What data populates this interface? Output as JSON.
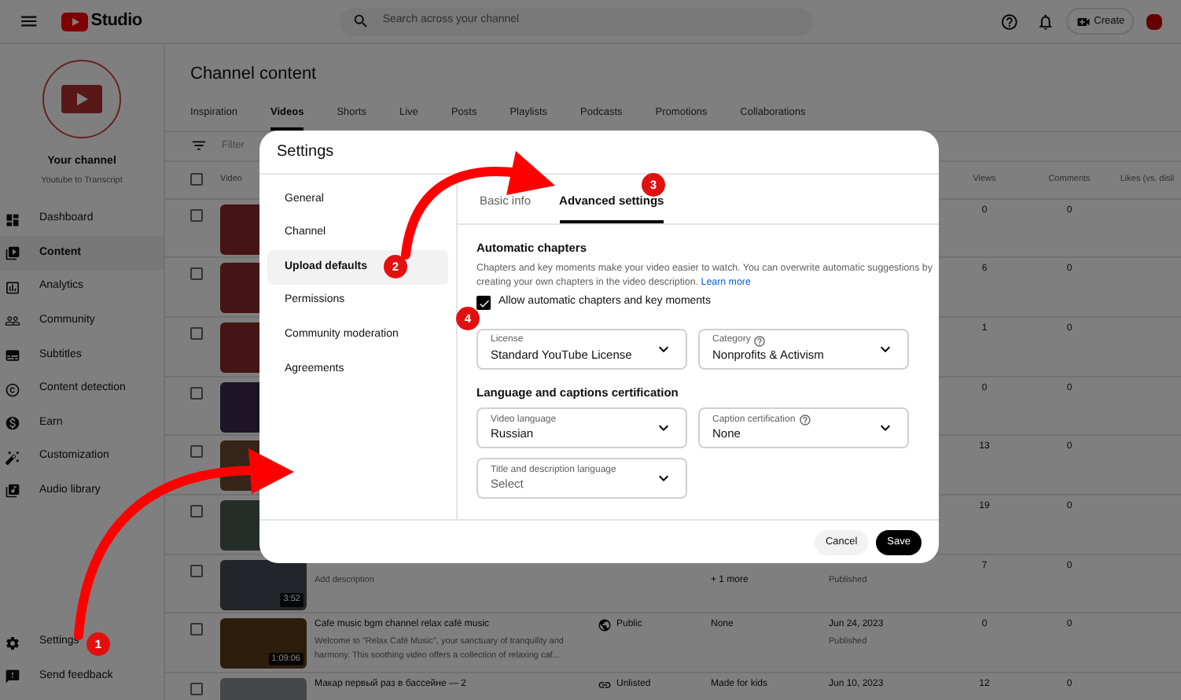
{
  "header": {
    "logo_text": "Studio",
    "search_placeholder": "Search across your channel",
    "create_label": "Create"
  },
  "sidebar": {
    "channel_name": "Your channel",
    "channel_handle": "Youtube to Transcript",
    "items": [
      {
        "label": "Dashboard",
        "selected": false
      },
      {
        "label": "Content",
        "selected": true
      },
      {
        "label": "Analytics",
        "selected": false
      },
      {
        "label": "Community",
        "selected": false
      },
      {
        "label": "Subtitles",
        "selected": false
      },
      {
        "label": "Content detection",
        "selected": false
      },
      {
        "label": "Earn",
        "selected": false
      },
      {
        "label": "Customization",
        "selected": false
      },
      {
        "label": "Audio library",
        "selected": false
      }
    ],
    "bottom_items": [
      {
        "label": "Settings"
      },
      {
        "label": "Send feedback"
      }
    ]
  },
  "page": {
    "title": "Channel content",
    "tabs": [
      {
        "label": "Inspiration",
        "selected": false
      },
      {
        "label": "Videos",
        "selected": true
      },
      {
        "label": "Shorts",
        "selected": false
      },
      {
        "label": "Live",
        "selected": false
      },
      {
        "label": "Posts",
        "selected": false
      },
      {
        "label": "Playlists",
        "selected": false
      },
      {
        "label": "Podcasts",
        "selected": false
      },
      {
        "label": "Promotions",
        "selected": false
      },
      {
        "label": "Collaborations",
        "selected": false
      }
    ],
    "filter_placeholder": "Filter"
  },
  "table": {
    "columns": {
      "video": "Video",
      "views": "Views",
      "comments": "Comments",
      "likes": "Likes (vs. disli"
    },
    "select_all_checked": false,
    "rows": [
      {
        "checked": false,
        "views": "0",
        "comments": "0"
      },
      {
        "checked": false,
        "views": "6",
        "comments": "0"
      },
      {
        "checked": false,
        "views": "1",
        "comments": "0"
      },
      {
        "checked": false,
        "views": "0",
        "comments": "0"
      },
      {
        "checked": false,
        "views": "13",
        "comments": "0"
      },
      {
        "checked": false,
        "views": "19",
        "comments": "0"
      },
      {
        "checked": false,
        "duration": "3:52",
        "description": "Add description",
        "restrictions_more": "+ 1 more",
        "status": "Published",
        "views": "7",
        "comments": "0"
      },
      {
        "checked": false,
        "duration": "1:09:06",
        "title": "Cafe music bgm channel relax café music",
        "description": "Welcome to \"Relax Café Music\", your sanctuary of tranquility and harmony. This soothing video offers a collection of relaxing caf...",
        "visibility": {
          "kind": "public",
          "label": "Public"
        },
        "restrictions": "None",
        "date": "Jun 24, 2023",
        "status": "Published",
        "views": "0",
        "comments": "0"
      },
      {
        "checked": false,
        "title": "Макар первый раз в бассейне — 2",
        "visibility": {
          "kind": "unlisted",
          "label": "Unlisted"
        },
        "restrictions": "Made for kids",
        "date": "Jun 10, 2023",
        "views": "12",
        "comments": "0"
      }
    ]
  },
  "dialog": {
    "title": "Settings",
    "nav": [
      {
        "label": "General",
        "selected": false
      },
      {
        "label": "Channel",
        "selected": false
      },
      {
        "label": "Upload defaults",
        "selected": true
      },
      {
        "label": "Permissions",
        "selected": false
      },
      {
        "label": "Community moderation",
        "selected": false
      },
      {
        "label": "Agreements",
        "selected": false
      }
    ],
    "tabs": [
      {
        "label": "Basic info",
        "selected": false
      },
      {
        "label": "Advanced settings",
        "selected": true
      }
    ],
    "chapters": {
      "heading": "Automatic chapters",
      "description": "Chapters and key moments make your video easier to watch. You can overwrite automatic suggestions by creating your own chapters in the video description.",
      "link": "Learn more",
      "checkbox_label": "Allow automatic chapters and key moments",
      "checked": true
    },
    "fields_top": [
      {
        "label": "License",
        "value": "Standard YouTube License",
        "help": false
      },
      {
        "label": "Category",
        "value": "Nonprofits & Activism",
        "help": true
      }
    ],
    "language_heading": "Language and captions certification",
    "fields_language": [
      {
        "label": "Video language",
        "value": "Russian",
        "help": false
      },
      {
        "label": "Caption certification",
        "value": "None",
        "help": true
      },
      {
        "label": "Title and description language",
        "placeholder": "Select",
        "help": false
      }
    ],
    "buttons": {
      "cancel": "Cancel",
      "save": "Save"
    }
  },
  "annotations": [
    {
      "label": "1"
    },
    {
      "label": "2"
    },
    {
      "label": "3"
    },
    {
      "label": "4"
    }
  ]
}
